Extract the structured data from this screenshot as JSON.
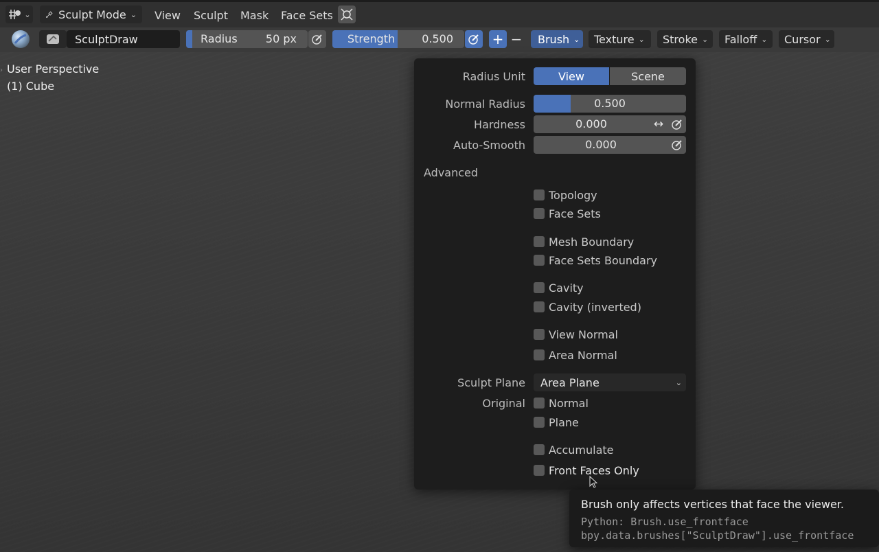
{
  "header": {
    "mode": {
      "label": "Sculpt Mode"
    },
    "menus": [
      "View",
      "Sculpt",
      "Mask",
      "Face Sets"
    ]
  },
  "toolbar": {
    "brush_name": "SculptDraw",
    "radius": {
      "label": "Radius",
      "value": "50 px",
      "fill_fraction": 0.0
    },
    "strength": {
      "label": "Strength",
      "value": "0.500",
      "fill_fraction": 0.5
    },
    "plus": "+",
    "minus": "−",
    "menus": [
      "Brush",
      "Texture",
      "Stroke",
      "Falloff",
      "Cursor"
    ]
  },
  "viewport": {
    "perspective": "User Perspective",
    "object": "(1) Cube"
  },
  "brush_popover": {
    "radius_unit": {
      "label": "Radius Unit",
      "options": [
        "View",
        "Scene"
      ],
      "selected": "View"
    },
    "normal_radius": {
      "label": "Normal Radius",
      "value": "0.500",
      "fill_fraction": 0.24
    },
    "hardness": {
      "label": "Hardness",
      "value": "0.000"
    },
    "auto_smooth": {
      "label": "Auto-Smooth",
      "value": "0.000"
    },
    "advanced_label": "Advanced",
    "checkboxes": {
      "topology": "Topology",
      "face_sets": "Face Sets",
      "mesh_boundary": "Mesh Boundary",
      "face_sets_boundary": "Face Sets Boundary",
      "cavity": "Cavity",
      "cavity_inverted": "Cavity (inverted)",
      "view_normal": "View Normal",
      "area_normal": "Area Normal",
      "normal": "Normal",
      "plane": "Plane",
      "accumulate": "Accumulate",
      "front_faces_only": "Front Faces Only"
    },
    "sculpt_plane": {
      "label": "Sculpt Plane",
      "value": "Area Plane"
    },
    "original_label": "Original"
  },
  "tooltip": {
    "description": "Brush only affects vertices that face the viewer.",
    "python_line1": "Python: Brush.use_frontface",
    "python_line2": "bpy.data.brushes[\"SculptDraw\"].use_frontface"
  }
}
